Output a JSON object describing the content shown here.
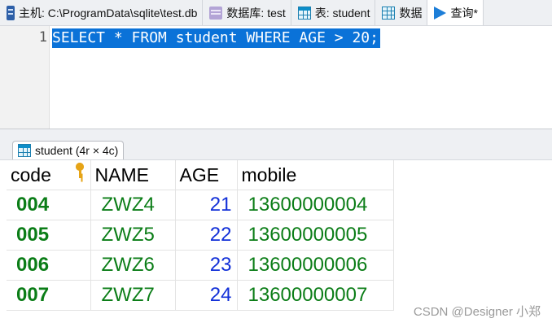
{
  "tabs": [
    {
      "icon": "database-icon",
      "label": "主机: C:\\ProgramData\\sqlite\\test.db"
    },
    {
      "icon": "schema-icon",
      "label": "数据库: test"
    },
    {
      "icon": "table-icon",
      "label": "表: student"
    },
    {
      "icon": "data-grid-icon",
      "label": "数据"
    },
    {
      "icon": "play-icon",
      "label": "查询*"
    }
  ],
  "editor": {
    "line_number": "1",
    "sql": "SELECT * FROM student WHERE AGE > 20;"
  },
  "result_tab": {
    "label": "student (4r × 4c)"
  },
  "grid": {
    "columns": [
      "code",
      "NAME",
      "AGE",
      "mobile"
    ],
    "primary_key_column": "code",
    "rows": [
      [
        "004",
        "ZWZ4",
        "21",
        "13600000004"
      ],
      [
        "005",
        "ZWZ5",
        "22",
        "13600000005"
      ],
      [
        "006",
        "ZWZ6",
        "23",
        "13600000006"
      ],
      [
        "007",
        "ZWZ7",
        "24",
        "13600000007"
      ]
    ]
  },
  "watermark": "CSDN @Designer 小郑",
  "colors": {
    "selection": "#0a72d8",
    "text_value": "#0b7d17",
    "number_value": "#1230d8",
    "key": "#e6a417"
  }
}
